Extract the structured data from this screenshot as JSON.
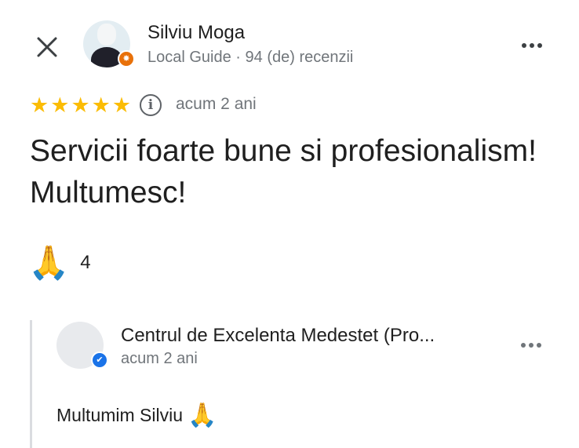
{
  "icons": {
    "close": "close-icon",
    "more": "more-horizontal-icon",
    "star": "star-icon",
    "info": "info-icon",
    "guide_badge": "local-guide-badge-icon",
    "verified": "verified-check-icon",
    "pray": "folded-hands-icon"
  },
  "colors": {
    "star": "#fbbc04",
    "guide_badge": "#e8710a",
    "verified_badge": "#1a73e8",
    "secondary_text": "#70757a"
  },
  "reviewer": {
    "name": "Silviu Moga",
    "meta": "Local Guide · 94 (de) recenzii"
  },
  "review": {
    "rating": 5,
    "star_glyph": "★",
    "info_glyph": "i",
    "date": "acum 2 ani",
    "text": "Servicii foarte bune si profesionalism! Multumesc!",
    "reaction_emoji": "🙏",
    "reaction_count": "4"
  },
  "owner_reply": {
    "name": "Centrul de Excelenta Medestet (Pro...",
    "date": "acum 2 ani",
    "text": "Multumim Silviu",
    "emoji": "🙏"
  }
}
